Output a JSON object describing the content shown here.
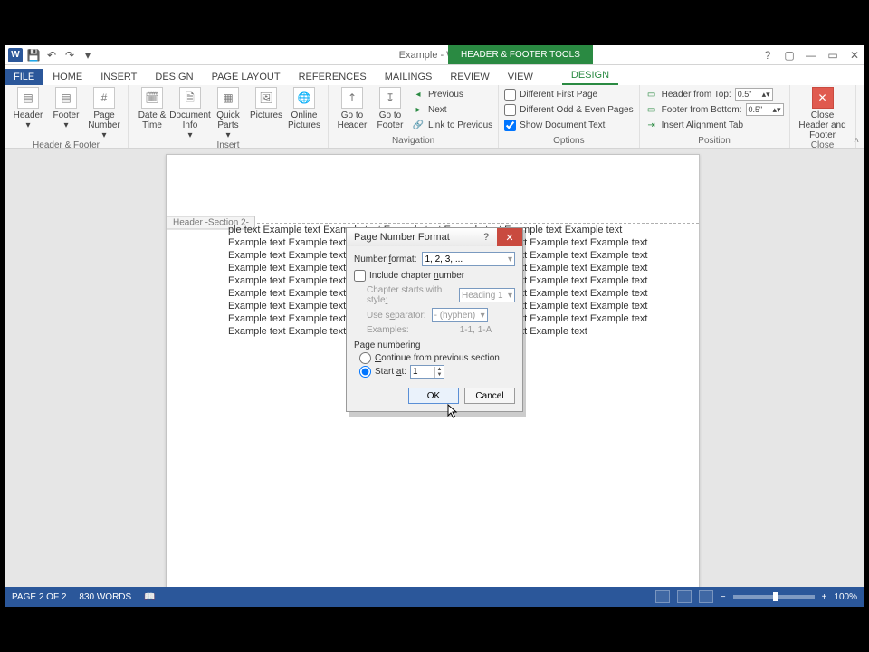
{
  "title": "Example - Word",
  "context_tab_group": "HEADER & FOOTER TOOLS",
  "tabs": [
    "FILE",
    "HOME",
    "INSERT",
    "DESIGN",
    "PAGE LAYOUT",
    "REFERENCES",
    "MAILINGS",
    "REVIEW",
    "VIEW",
    "DESIGN"
  ],
  "ribbon": {
    "hf_group_label": "Header & Footer",
    "header": "Header",
    "footer": "Footer",
    "page_number": "Page Number",
    "insert_group_label": "Insert",
    "date_time": "Date & Time",
    "doc_info": "Document Info",
    "quick_parts": "Quick Parts",
    "pictures": "Pictures",
    "online_pictures": "Online Pictures",
    "nav_group_label": "Navigation",
    "goto_header": "Go to Header",
    "goto_footer": "Go to Footer",
    "previous": "Previous",
    "next": "Next",
    "link_prev": "Link to Previous",
    "options_group_label": "Options",
    "diff_first": "Different First Page",
    "diff_oe": "Different Odd & Even Pages",
    "show_doc": "Show Document Text",
    "position_group_label": "Position",
    "header_top": "Header from Top:",
    "footer_bottom": "Footer from Bottom:",
    "insert_align": "Insert Alignment Tab",
    "pos_value": "0.5\"",
    "close_group_label": "Close",
    "close_hf": "Close Header and Footer"
  },
  "doc": {
    "header_tab": "Header -Section 2-",
    "body": "ple text Example text Example text Example text Example text Example text Example text Example text Example text Example text Example text Example text Example text Example text Example text Example text Example text Example text Example text Example text Example text Example text Example text Example text Example text Example text Example text Example text Example text Example text Example text Example text Example text Example text Example text Example text Example text Example text Example text Example text Example text Example text Example text Example text Example text Example text Example text Example text Example text Example text Example text Example text Example text Example text Example text Example text Example text Example text Example text Example text Example text Example text"
  },
  "dialog": {
    "title": "Page Number Format",
    "number_format_label": "Number format:",
    "number_format_value": "1, 2, 3, ...",
    "include_chapter": "Include chapter number",
    "chapter_style_label": "Chapter starts with style:",
    "chapter_style_value": "Heading 1",
    "separator_label": "Use separator:",
    "separator_value": "- (hyphen)",
    "examples_label": "Examples:",
    "examples_value": "1-1, 1-A",
    "page_numbering_label": "Page numbering",
    "continue_label": "Continue from previous section",
    "start_at_label": "Start at:",
    "start_at_value": "1",
    "ok": "OK",
    "cancel": "Cancel"
  },
  "status": {
    "page": "PAGE 2 OF 2",
    "words": "830 WORDS",
    "zoom": "100%"
  }
}
